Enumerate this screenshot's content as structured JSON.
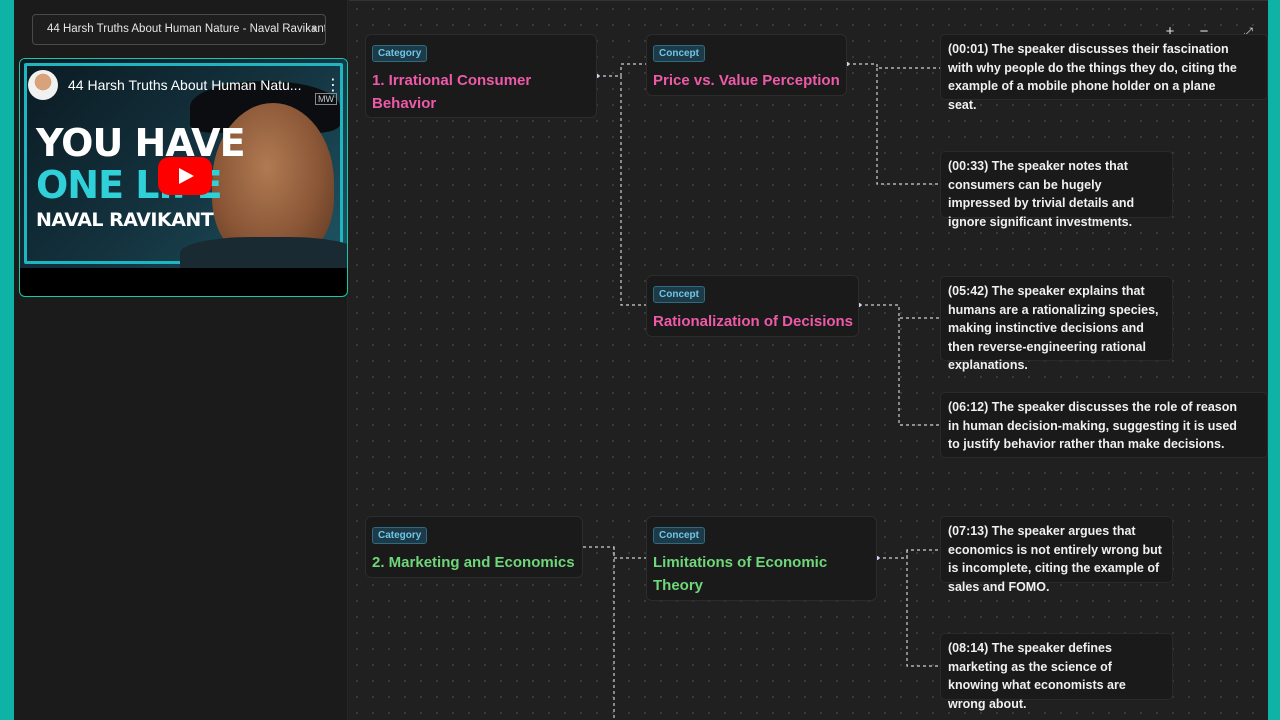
{
  "sidebar": {
    "video_select": "44 Harsh Truths About Human Nature - Naval Ravikant (",
    "player": {
      "title": "44 Harsh Truths About Human Natu...",
      "thumb_line1": "YOU HAVE",
      "thumb_line2": "ONE LIFE",
      "thumb_line3": "NAVAL RAVIKANT",
      "badge": "MW"
    }
  },
  "controls": {
    "zoom_in": "+",
    "zoom_out": "−",
    "fit": "⤢"
  },
  "nodes": {
    "cat1": {
      "tag": "Category",
      "title": "1. Irrational Consumer Behavior"
    },
    "con1": {
      "tag": "Concept",
      "title": "Price vs. Value Perception"
    },
    "con2": {
      "tag": "Concept",
      "title": "Rationalization of Decisions"
    },
    "cat2": {
      "tag": "Category",
      "title": "2. Marketing and Economics"
    },
    "con3": {
      "tag": "Concept",
      "title": "Limitations of Economic Theory"
    }
  },
  "notes": [
    "(00:01) The speaker discusses their fascination with why people do the things they do, citing the example of a mobile phone holder on a plane seat.",
    "(00:33) The speaker notes that consumers can be hugely impressed by trivial details and ignore significant investments.",
    "(05:42) The speaker explains that humans are a rationalizing species, making instinctive decisions and then reverse-engineering rational explanations.",
    "(06:12) The speaker discusses the role of reason in human decision-making, suggesting it is used to justify behavior rather than make decisions.",
    "(07:13) The speaker argues that economics is not entirely wrong but is incomplete, citing the example of sales and FOMO.",
    "(08:14) The speaker defines marketing as the science of knowing what economists are wrong about."
  ],
  "colors": {
    "category_title": "#ee5aa8",
    "category2_title": "#6fd67a",
    "accent": "#19c8a9"
  }
}
